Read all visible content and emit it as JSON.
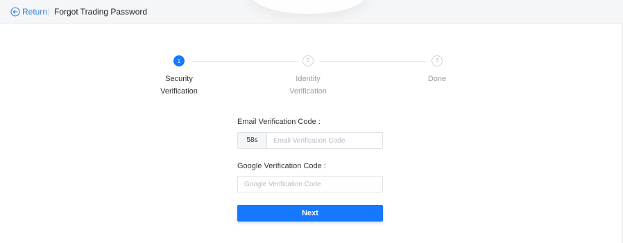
{
  "header": {
    "back_label": "Return",
    "title": "Forgot Trading Password"
  },
  "steps": [
    {
      "number": "1",
      "label_line1": "Security",
      "label_line2": "Verification",
      "state": "active"
    },
    {
      "number": "2",
      "label_line1": "Identity",
      "label_line2": "Verification",
      "state": "inactive"
    },
    {
      "number": "3",
      "label_line1": "Done",
      "label_line2": "",
      "state": "inactive"
    }
  ],
  "form": {
    "email_label": "Email Verification Code :",
    "email_countdown": "58s",
    "email_placeholder": "Email Verification Code",
    "google_label": "Google Verification Code :",
    "google_placeholder": "Google Verification Code",
    "next_label": "Next"
  },
  "colors": {
    "accent": "#1677ff",
    "link": "#2f80ed",
    "inactive": "#b8bcc2"
  }
}
